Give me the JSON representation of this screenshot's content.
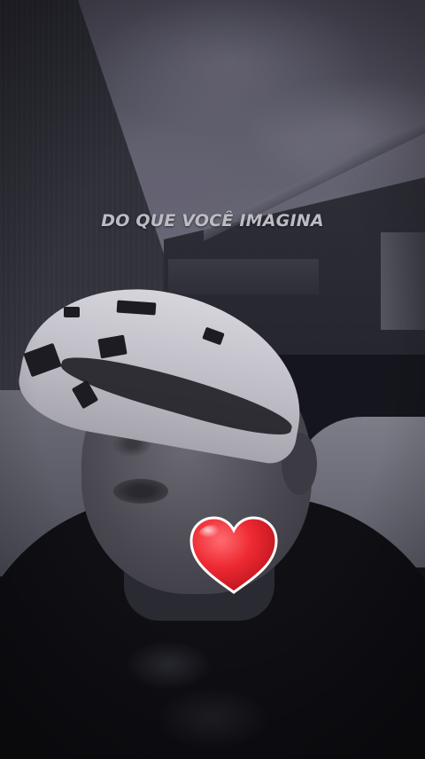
{
  "story": {
    "caption": "DO QUE VOCÊ IMAGINA",
    "sticker_icon": "red-heart-emoji",
    "caption_color": "#bdbcc4",
    "heart_color": "#e8222c"
  }
}
